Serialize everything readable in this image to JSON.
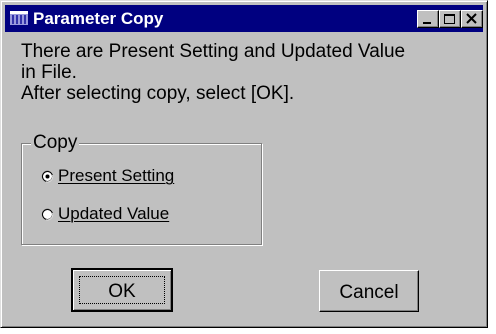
{
  "window": {
    "title": "Parameter Copy",
    "colors": {
      "titlebar": "#000080",
      "face": "#c0c0c0"
    }
  },
  "titlebar_buttons": {
    "minimize_icon": "minimize-icon",
    "maximize_icon": "maximize-icon",
    "close_icon": "close-icon"
  },
  "message": {
    "line1": "There are Present Setting and Updated Value",
    "line2": "in File.",
    "line3": "After selecting copy, select [OK]."
  },
  "copy_group": {
    "label": "Copy",
    "options": [
      {
        "label": "Present Setting",
        "selected": true
      },
      {
        "label": "Updated Value",
        "selected": false
      }
    ]
  },
  "buttons": {
    "ok_label": "OK",
    "cancel_label": "Cancel"
  }
}
